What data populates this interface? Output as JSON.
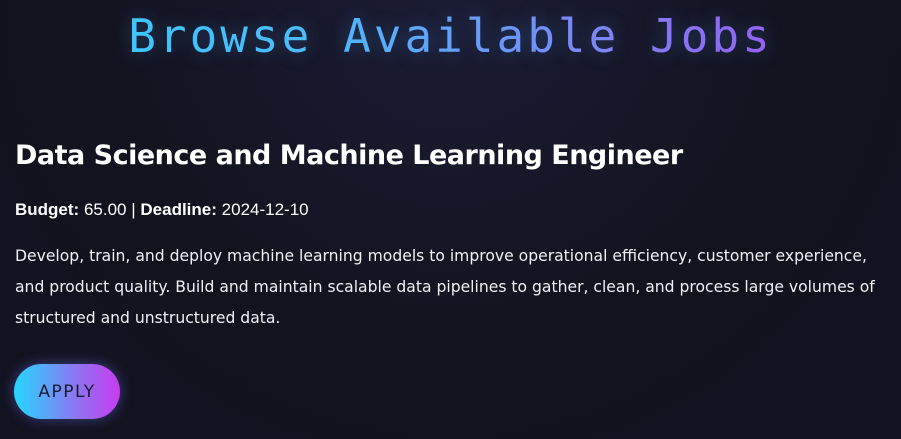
{
  "page": {
    "title": "Browse Available Jobs"
  },
  "job": {
    "title": "Data Science and Machine Learning Engineer",
    "budget_label": "Budget:",
    "budget_value": "65.00",
    "separator": "|",
    "deadline_label": "Deadline:",
    "deadline_value": "2024-12-10",
    "description": "Develop, train, and deploy machine learning models to improve operational efficiency, customer experience, and product quality. Build and maintain scalable data pipelines to gather, clean, and process large volumes of structured and unstructured data.",
    "apply_label": "APPLY"
  },
  "colors": {
    "background": "#13131f",
    "title_gradient_start": "#2fd3ff",
    "title_gradient_end": "#b03ef2",
    "button_gradient_start": "#25d7ff",
    "button_gradient_end": "#c83cf0",
    "text": "#ffffff"
  }
}
